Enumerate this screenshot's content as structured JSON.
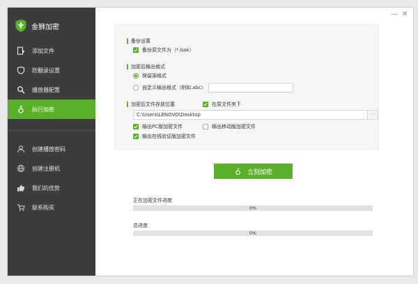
{
  "app": {
    "title": "金狮加密"
  },
  "sidebar": {
    "items": [
      {
        "label": "添加文件",
        "icon": "add-file-icon"
      },
      {
        "label": "防翻录设置",
        "icon": "shield-icon"
      },
      {
        "label": "播放器配置",
        "icon": "search-icon"
      },
      {
        "label": "执行加密",
        "icon": "lock-icon",
        "active": true
      }
    ],
    "secondary": [
      {
        "label": "创建播放密码",
        "icon": "user-icon"
      },
      {
        "label": "创建注册机",
        "icon": "globe-icon"
      },
      {
        "label": "我们的优势",
        "icon": "thumbs-up-icon"
      },
      {
        "label": "联系购买",
        "icon": "cart-icon"
      }
    ]
  },
  "window_controls": {
    "minimize": "—",
    "close": "✕"
  },
  "backup": {
    "title": "备份设置",
    "option": {
      "label": "备份原文件为（*.bak）",
      "checked": true
    }
  },
  "output_format": {
    "title": "加密后输出格式",
    "keep": {
      "label": "保留源格式",
      "selected": true
    },
    "custom": {
      "label": "自定义输出格式（例如.abc）",
      "selected": false,
      "value": ""
    }
  },
  "save_location": {
    "title": "加密后文件存放位置",
    "same_folder": {
      "label": "在原文件夹下",
      "checked": true
    },
    "path": "C:\\Users\\LENOVO\\Desktop",
    "browse": "···",
    "pc": {
      "label": "输出PC版加密文件",
      "checked": true
    },
    "mobile": {
      "label": "输出移动版加密文件",
      "checked": false
    },
    "online": {
      "label": "输出在线验证版加密文件",
      "checked": true
    }
  },
  "action": {
    "encrypt_label": "立刻加密"
  },
  "progress": {
    "current": {
      "label": "正在加密文件进度",
      "value": 0,
      "text": "0%"
    },
    "total": {
      "label": "总进度",
      "value": 0,
      "text": "0%"
    }
  },
  "colors": {
    "accent": "#5bb02a",
    "sidebar_bg": "#3c3c3c"
  }
}
